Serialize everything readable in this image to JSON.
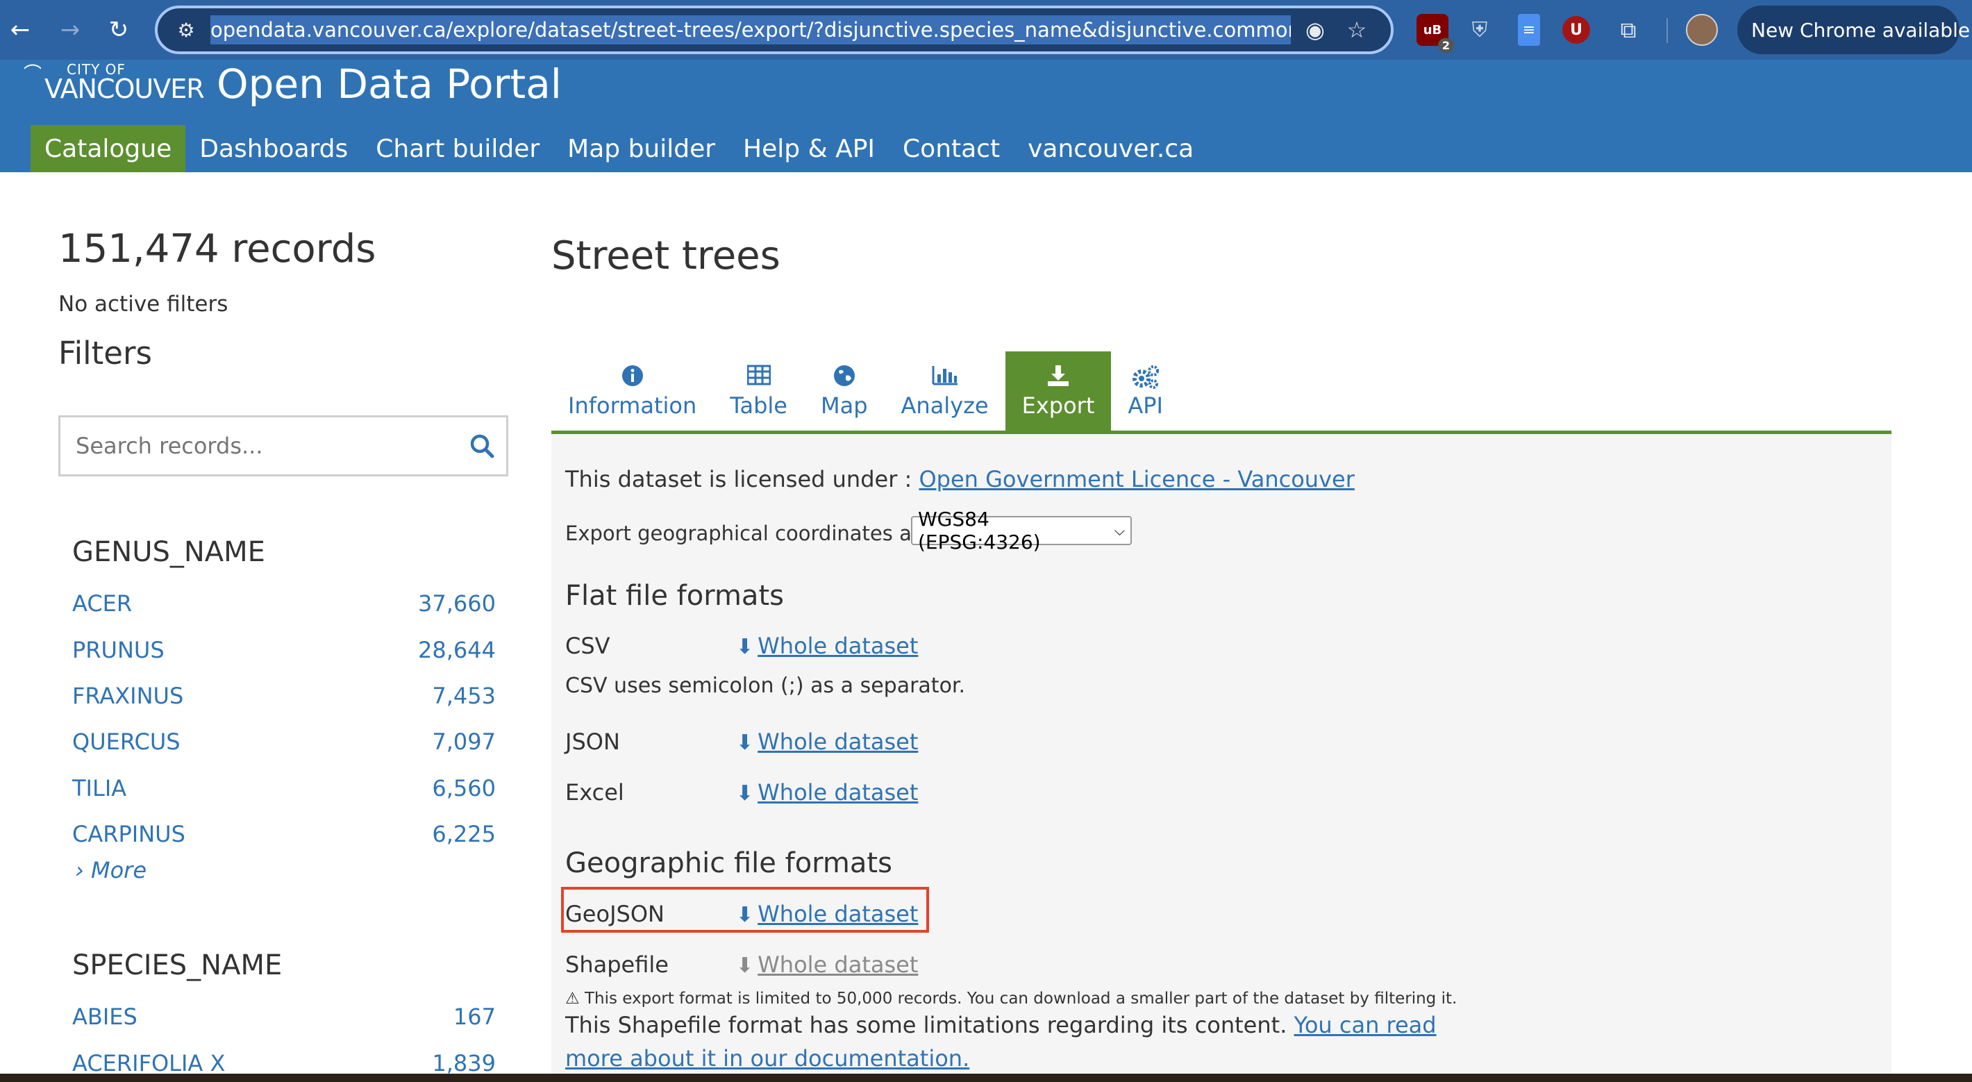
{
  "browser": {
    "url": "opendata.vancouver.ca/explore/dataset/street-trees/export/?disjunctive.species_name&disjunctive.common_name&di",
    "extension_badge": "2",
    "extension_u_label": "U",
    "new_chrome_label": "New Chrome available"
  },
  "header": {
    "logo_city_of": "CITY OF",
    "logo_vancouver": "VANCOUVER",
    "portal_title": "Open Data Portal",
    "nav": [
      "Catalogue",
      "Dashboards",
      "Chart builder",
      "Map builder",
      "Help & API",
      "Contact",
      "vancouver.ca"
    ]
  },
  "sidebar": {
    "records": "151,474 records",
    "filters_status": "No active filters",
    "filters_heading": "Filters",
    "search_placeholder": "Search records...",
    "facets": [
      {
        "title": "GENUS_NAME",
        "items": [
          {
            "name": "ACER",
            "count": "37,660"
          },
          {
            "name": "PRUNUS",
            "count": "28,644"
          },
          {
            "name": "FRAXINUS",
            "count": "7,453"
          },
          {
            "name": "QUERCUS",
            "count": "7,097"
          },
          {
            "name": "TILIA",
            "count": "6,560"
          },
          {
            "name": "CARPINUS",
            "count": "6,225"
          }
        ],
        "more": "› More"
      },
      {
        "title": "SPECIES_NAME",
        "items": [
          {
            "name": "ABIES",
            "count": "167"
          },
          {
            "name": "ACERIFOLIA X",
            "count": "1,839"
          }
        ]
      }
    ]
  },
  "main": {
    "title": "Street trees",
    "tabs": [
      {
        "label": "Information",
        "icon": "info-icon"
      },
      {
        "label": "Table",
        "icon": "table-icon"
      },
      {
        "label": "Map",
        "icon": "globe-icon"
      },
      {
        "label": "Analyze",
        "icon": "bar-chart-icon"
      },
      {
        "label": "Export",
        "icon": "download-icon"
      },
      {
        "label": "API",
        "icon": "gears-icon"
      }
    ],
    "license_prefix": "This dataset is licensed under : ",
    "license_link": "Open Government Licence - Vancouver",
    "coords_label": "Export geographical coordinates as:",
    "coords_value": "WGS84 (EPSG:4326)",
    "flat_heading": "Flat file formats",
    "geo_heading": "Geographic file formats",
    "whole_dataset": "Whole dataset",
    "formats": {
      "csv": "CSV",
      "csv_note": "CSV uses semicolon (;) as a separator.",
      "json": "JSON",
      "excel": "Excel",
      "geojson": "GeoJSON",
      "shapefile": "Shapefile"
    },
    "shapefile_limit_note": "This export format is limited to 50,000 records. You can download a smaller part of the dataset by filtering it.",
    "shapefile_limitations": "This Shapefile format has some limitations regarding its content. ",
    "doc_link_1": "You can read",
    "doc_link_2": "more about it in our documentation."
  }
}
